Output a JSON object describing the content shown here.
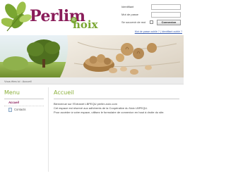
{
  "header": {
    "logo_main": "Perlim",
    "logo_registered": "®",
    "logo_sub": "noix"
  },
  "login": {
    "identifier_label": "Identifiant",
    "password_label": "Mot de passe",
    "remember_label": "Se souvenir de moi",
    "submit_label": "Connexion",
    "forgot_link": "Mot de passe oublié ? | Identifiant oublié ?"
  },
  "breadcrumb": "Vous êtes ici : Accueil",
  "menu": {
    "title": "Menu",
    "items": [
      {
        "label": "Accueil"
      },
      {
        "label": "Contacts"
      }
    ]
  },
  "main": {
    "title": "Accueil",
    "paragraphs": [
      "Bienvenue sur l'Extranet LBPEQU perlim-noix.com",
      "Cet espace est réservé aux adhérents de la Coopérative du Noix LBPEQU.",
      "Pour accéder à votre espace, utilisez le formulaire de connexion en haut à droite du site."
    ]
  },
  "colors": {
    "brand_plum": "#8a1d5a",
    "brand_green": "#7aa632",
    "title_green": "#8bb03a"
  },
  "icons": [
    "leaves-logo-icon",
    "registered-icon",
    "document-icon"
  ]
}
